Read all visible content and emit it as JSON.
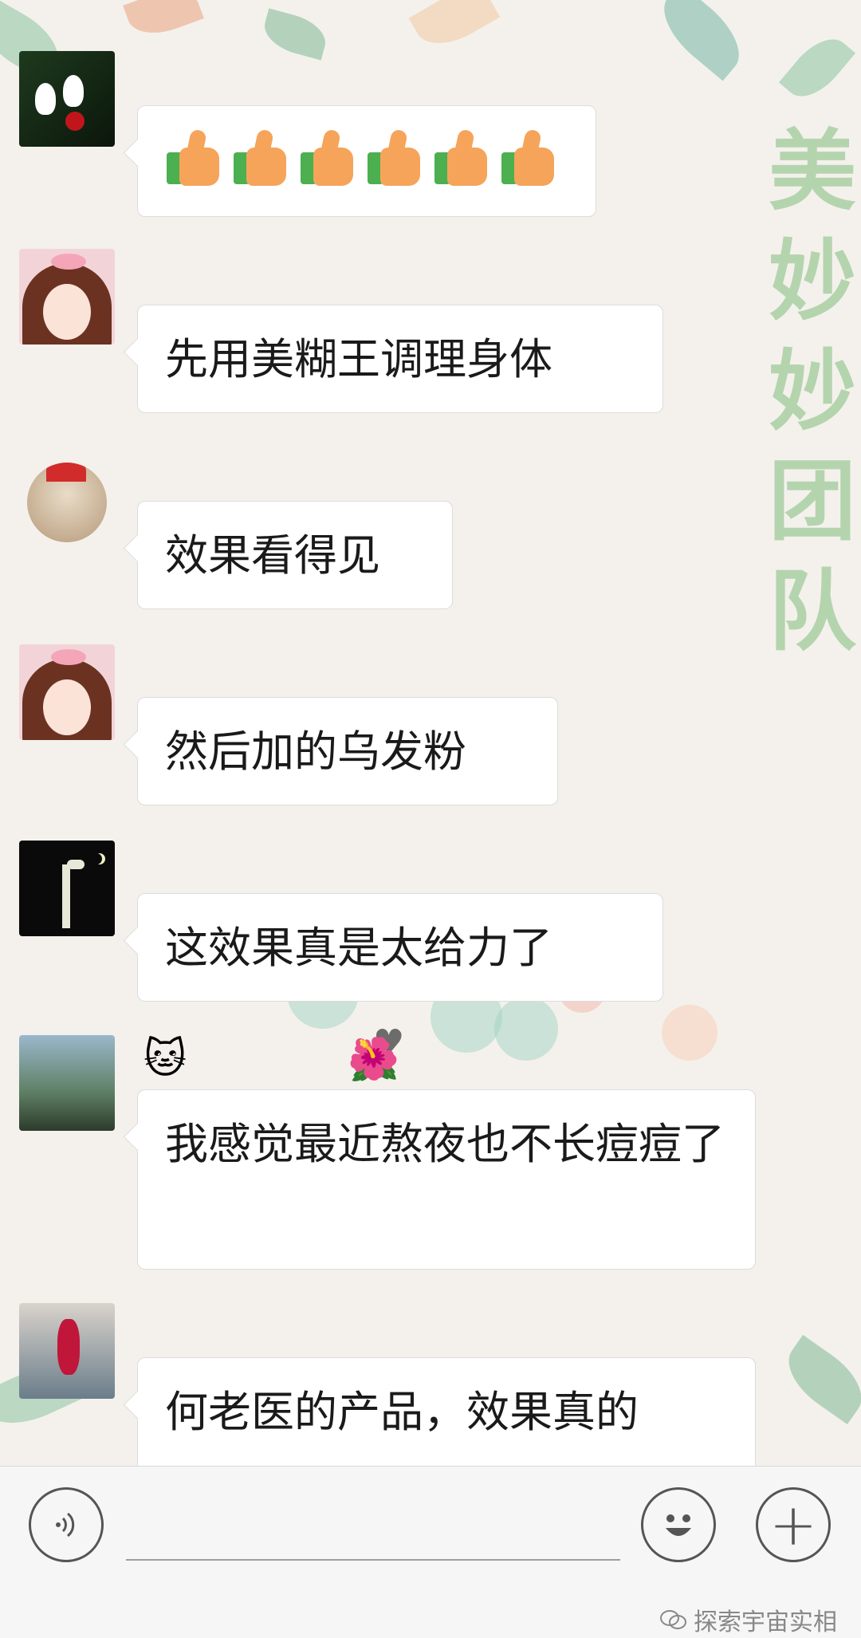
{
  "colors": {
    "accent_green": "#4caf50",
    "bubble_bg": "#ffffff",
    "side_title": "#a9cfa4"
  },
  "background": {
    "side_title_chars": [
      "美",
      "妙",
      "妙",
      "团",
      "队"
    ]
  },
  "messages": [
    {
      "type": "emoji",
      "emoji": "thumbs-up",
      "count": 6
    },
    {
      "text": "先用美糊王调理身体"
    },
    {
      "text": "效果看得见"
    },
    {
      "text": "然后加的乌发粉"
    },
    {
      "text": "这效果真是太给力了"
    },
    {
      "text": "我感觉最近熬夜也不长痘痘了",
      "nick_emoji_left": "🐱",
      "nick_emoji_right": "🌺"
    },
    {
      "text": "何老医的产品，效果真的"
    }
  ],
  "input_bar": {
    "voice_icon": "voice-icon",
    "emoji_icon": "smiley-icon",
    "plus_icon": "plus-icon",
    "plus_label": "+"
  },
  "watermark": {
    "text": "探索宇宙实相"
  }
}
